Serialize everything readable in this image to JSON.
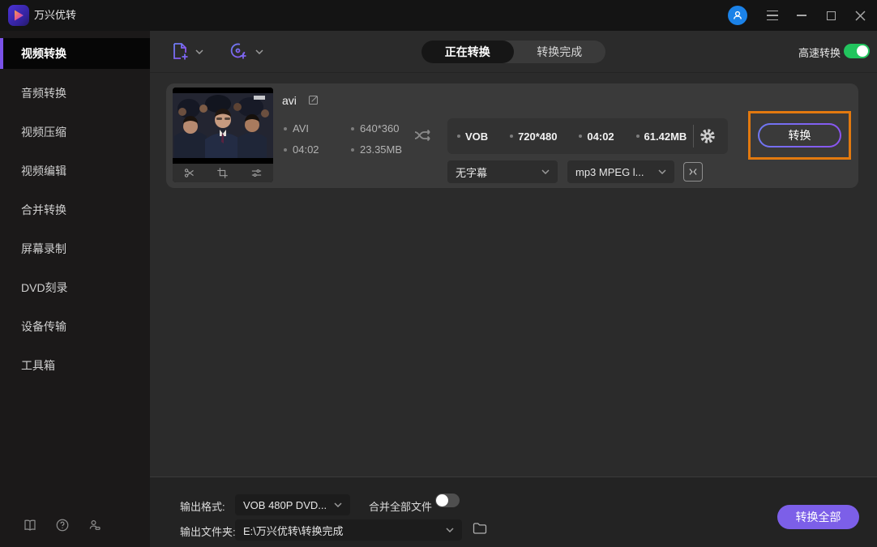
{
  "app": {
    "title": "万兴优转"
  },
  "header": {
    "tabs": {
      "converting": "正在转换",
      "finished": "转换完成"
    },
    "fast_convert_label": "高速转换"
  },
  "sidebar": {
    "items": [
      {
        "label": "视频转换"
      },
      {
        "label": "音频转换"
      },
      {
        "label": "视频压缩"
      },
      {
        "label": "视频编辑"
      },
      {
        "label": "合并转换"
      },
      {
        "label": "屏幕录制"
      },
      {
        "label": "DVD刻录"
      },
      {
        "label": "设备传输"
      },
      {
        "label": "工具箱"
      }
    ]
  },
  "task": {
    "name": "avi",
    "source": {
      "format": "AVI",
      "resolution": "640*360",
      "duration": "04:02",
      "size": "23.35MB"
    },
    "output": {
      "format": "VOB",
      "resolution": "720*480",
      "duration": "04:02",
      "size": "61.42MB"
    },
    "subtitle": "无字幕",
    "audio_track": "mp3 MPEG l...",
    "convert_label": "转换"
  },
  "footer": {
    "output_format_label": "输出格式:",
    "output_format_value": "VOB 480P DVD...",
    "merge_all_label": "合并全部文件",
    "output_folder_label": "输出文件夹:",
    "output_folder_value": "E:\\万兴优转\\转换完成",
    "convert_all_label": "转换全部"
  },
  "colors": {
    "accent_purple": "#7c5ce6",
    "highlight_orange": "#e2790f",
    "toggle_green": "#22c45e",
    "avatar_blue": "#1b82e8"
  }
}
